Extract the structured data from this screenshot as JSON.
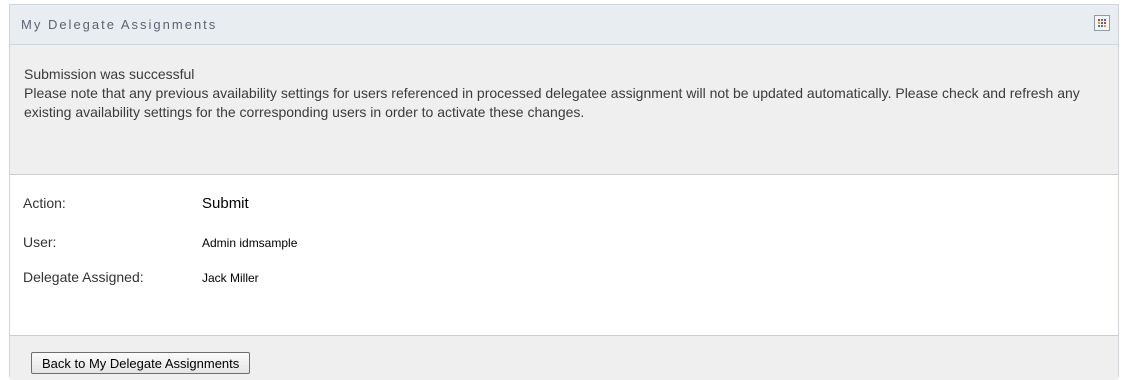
{
  "panel": {
    "title": "My Delegate Assignments",
    "header_button_icon": "color-grid-icon"
  },
  "message": {
    "line1": "Submission was successful",
    "line2": "Please note that any previous availability settings for users referenced in processed delegatee assignment will not be updated automatically. Please check and refresh any existing availability settings for the corresponding users in order to activate these changes."
  },
  "details": {
    "action_label": "Action:",
    "action_value": "Submit",
    "user_label": "User:",
    "user_value": "Admin idmsample",
    "delegate_label": "Delegate Assigned:",
    "delegate_value": "Jack Miller"
  },
  "footer": {
    "back_button_label": "Back to My Delegate Assignments"
  },
  "colors": {
    "header_bg": "#e8edf2",
    "message_bg": "#efefef",
    "border": "#cccccc"
  }
}
